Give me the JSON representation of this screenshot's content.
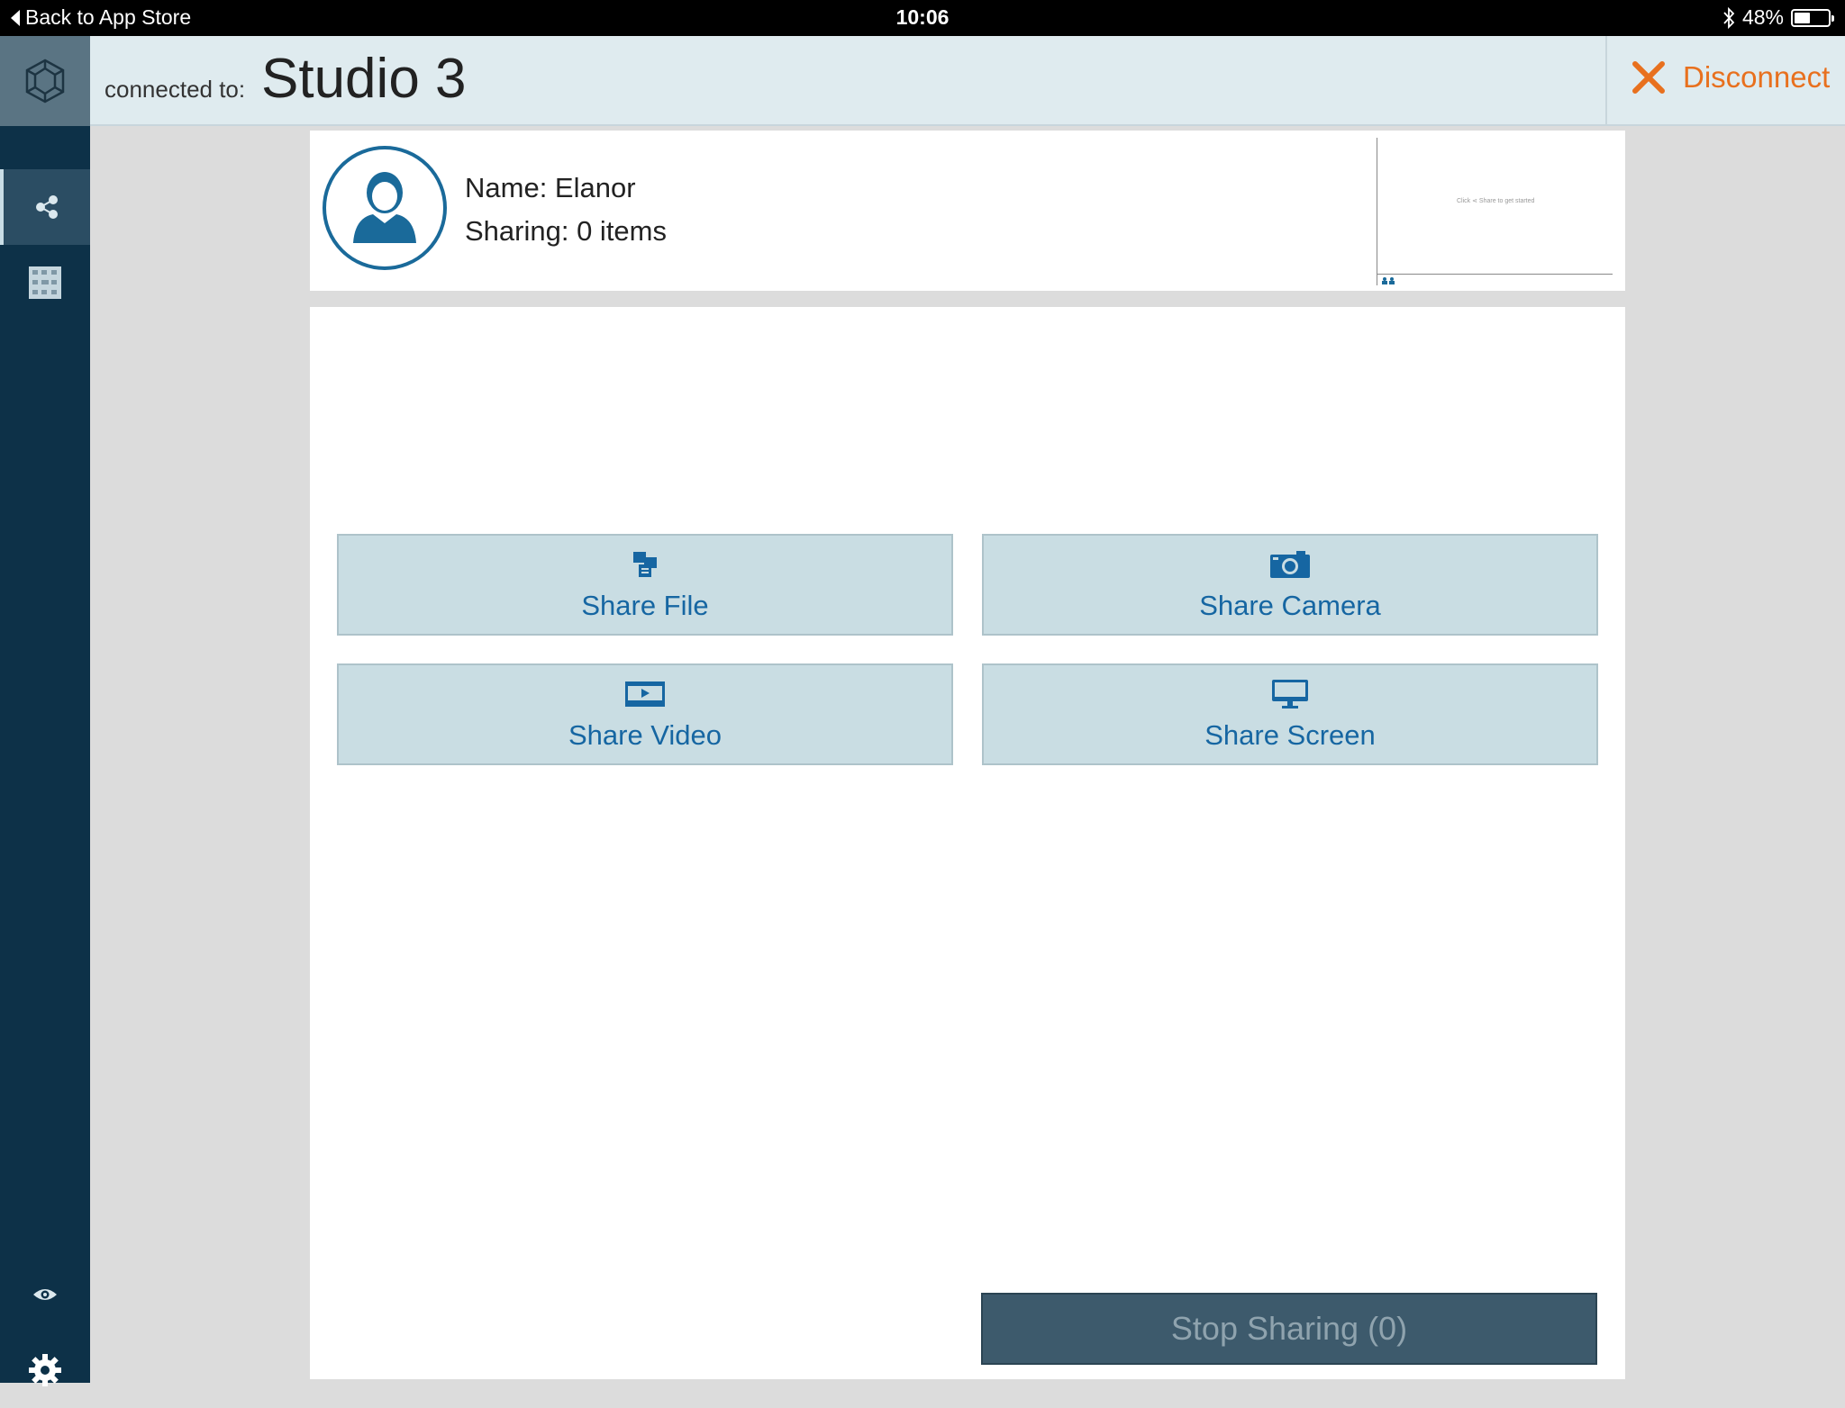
{
  "status_bar": {
    "back_label": "Back to App Store",
    "time": "10:06",
    "battery_text": "48%",
    "battery_level": 0.48
  },
  "sidebar": {
    "logo_icon": "polyhedron-logo-icon",
    "items": [
      {
        "name": "share-nav",
        "icon": "share-icon",
        "active": true
      },
      {
        "name": "layout-nav",
        "icon": "grid-layout-icon",
        "active": false
      }
    ],
    "bottom_items": [
      {
        "name": "view-nav",
        "icon": "eye-icon"
      },
      {
        "name": "settings-nav",
        "icon": "gear-icon"
      }
    ]
  },
  "header": {
    "connected_label": "connected to:",
    "room_name": "Studio 3",
    "disconnect_label": "Disconnect",
    "disconnect_color": "#e8701e"
  },
  "profile": {
    "name_text": "Name: Elanor",
    "sharing_text": "Sharing: 0 items",
    "preview_text": "Click ⋖ Share to get started"
  },
  "share_buttons": {
    "file": "Share File",
    "camera": "Share Camera",
    "video": "Share Video",
    "screen": "Share Screen"
  },
  "stop_button": {
    "label": "Stop Sharing (0)"
  },
  "colors": {
    "sidebar_bg": "#0d3148",
    "header_bg": "#dfebef",
    "button_bg": "#c9dde3",
    "button_text": "#1666a2",
    "stop_bg": "#3d5a6c"
  }
}
